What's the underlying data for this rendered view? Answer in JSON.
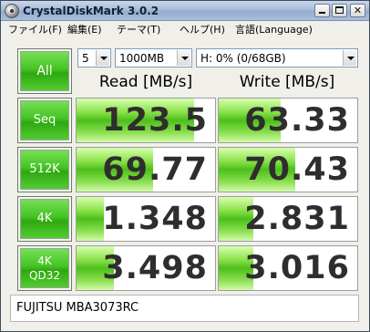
{
  "window": {
    "title": "CrystalDiskMark 3.0.2",
    "minimize_glyph": "",
    "maximize_glyph": "",
    "close_glyph": "✕"
  },
  "menu": {
    "file": "ファイル(F)",
    "edit": "編集(E)",
    "theme": "テーマ(T)",
    "help": "ヘルプ(H)",
    "language": "言語(Language)"
  },
  "controls": {
    "all_label": "All",
    "test_count": "5",
    "test_size": "1000MB",
    "drive": "H: 0% (0/68GB)"
  },
  "headers": {
    "read": "Read [MB/s]",
    "write": "Write [MB/s]"
  },
  "tests": [
    {
      "label": "Seq",
      "label_line2": "",
      "read": "123.5",
      "write": "63.33",
      "read_fill": 0.85,
      "write_fill": 0.45
    },
    {
      "label": "512K",
      "label_line2": "",
      "read": "69.77",
      "write": "70.43",
      "read_fill": 0.55,
      "write_fill": 0.55
    },
    {
      "label": "4K",
      "label_line2": "",
      "read": "1.348",
      "write": "2.831",
      "read_fill": 0.2,
      "write_fill": 0.25
    },
    {
      "label": "4K",
      "label_line2": "QD32",
      "read": "3.498",
      "write": "3.016",
      "read_fill": 0.27,
      "write_fill": 0.25
    }
  ],
  "comment": "FUJITSU MBA3073RC",
  "colors": {
    "button_green": "#3fbf1f",
    "bar_green": "#4cbf1b"
  }
}
